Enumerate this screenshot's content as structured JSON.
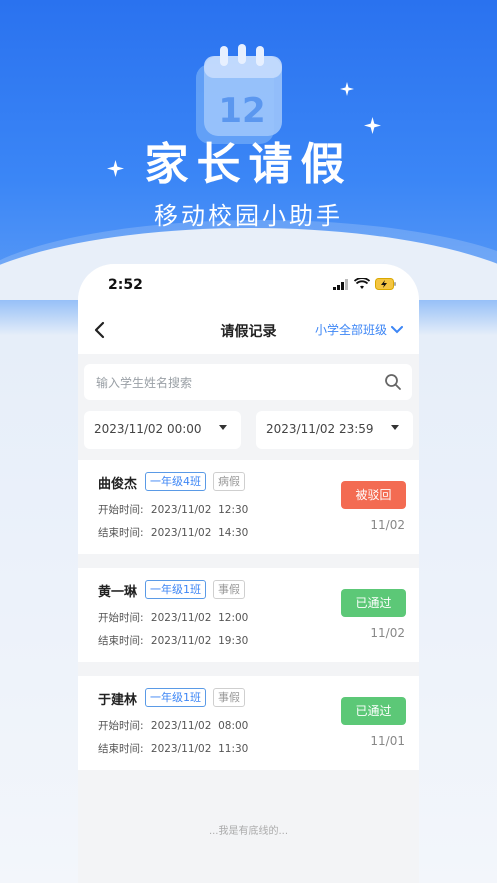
{
  "hero": {
    "title": "家长请假",
    "subtitle": "移动校园小助手",
    "calendar_number": "12"
  },
  "status_bar": {
    "time": "2:52"
  },
  "nav": {
    "title": "请假记录",
    "class_filter": "小学全部班级"
  },
  "search": {
    "placeholder": "输入学生姓名搜索"
  },
  "date_range": {
    "start": "2023/11/02 00:00",
    "end": "2023/11/02 23:59"
  },
  "labels": {
    "start": "开始时间:",
    "end": "结束时间:"
  },
  "records": [
    {
      "name": "曲俊杰",
      "class": "一年级4班",
      "type": "病假",
      "start": "2023/11/02  12:30",
      "end": "2023/11/02  14:30",
      "status": "被驳回",
      "status_color": "#f36b52",
      "date": "11/02"
    },
    {
      "name": "黄一琳",
      "class": "一年级1班",
      "type": "事假",
      "start": "2023/11/02  12:00",
      "end": "2023/11/02  19:30",
      "status": "已通过",
      "status_color": "#5cc877",
      "date": "11/02"
    },
    {
      "name": "于建林",
      "class": "一年级1班",
      "type": "事假",
      "start": "2023/11/02  08:00",
      "end": "2023/11/02  11:30",
      "status": "已通过",
      "status_color": "#5cc877",
      "date": "11/01"
    }
  ],
  "footer": "...我是有底线的..."
}
